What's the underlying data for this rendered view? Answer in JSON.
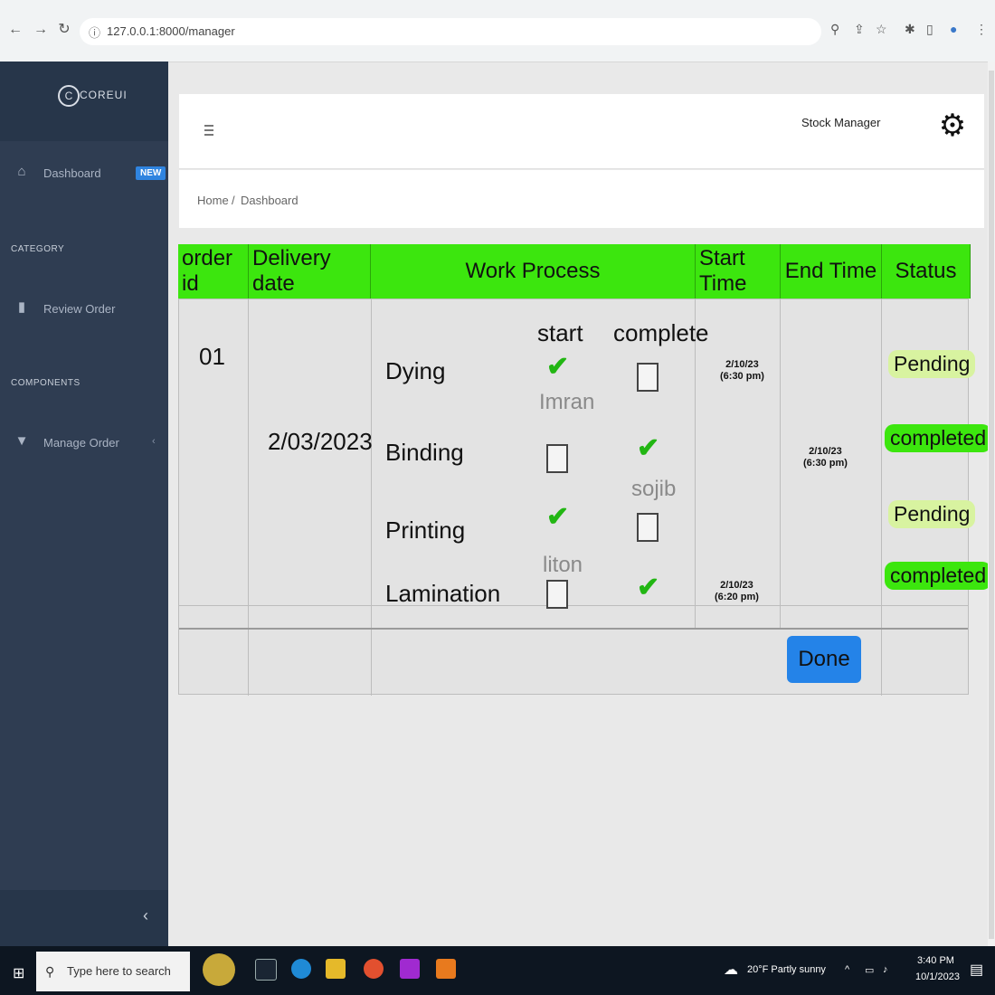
{
  "browser": {
    "url": "127.0.0.1:8000/manager",
    "nav": [
      "back-icon",
      "forward-icon",
      "reload-icon"
    ],
    "toolbar_icons": [
      "zoom-icon",
      "share-icon",
      "star-icon",
      "extensions-icon",
      "sidebar-icon",
      "profile-icon",
      "menu-icon"
    ]
  },
  "sidebar": {
    "brand": "COREUI",
    "dashboard": {
      "label": "Dashboard",
      "badge": "NEW"
    },
    "category_title": "CATEGORY",
    "review_order": "Review Order",
    "components_title": "COMPONENTS",
    "manage_order": "Manage Order",
    "collapse_icon": "chevron-left-icon"
  },
  "header": {
    "user": "Stock Manager",
    "settings_icon": "gear-icon"
  },
  "breadcrumb": {
    "home": "Home",
    "sep": "/",
    "current": "Dashboard"
  },
  "table": {
    "headers": [
      "order id",
      "Delivery date",
      "Work Process",
      "Start Time",
      "End Time",
      "Status"
    ],
    "order_id": "01",
    "delivery_date": "2/03/2023",
    "col_start": "start",
    "col_complete": "complete",
    "steps": [
      {
        "name": "Dying",
        "start": true,
        "complete": false,
        "worker": "Imran",
        "status": "Pending"
      },
      {
        "name": "Binding",
        "start": false,
        "complete": true,
        "worker": "sojib",
        "status": "completed"
      },
      {
        "name": "Printing",
        "start": true,
        "complete": false,
        "worker": "liton",
        "status": "Pending"
      },
      {
        "name": "Lamination",
        "start": false,
        "complete": true,
        "worker": "",
        "status": "completed"
      }
    ],
    "start_time_1": {
      "date": "2/10/23",
      "time": "(6:30 pm)"
    },
    "end_time": {
      "date": "2/10/23",
      "time": "(6:30 pm)"
    },
    "start_time_2": {
      "date": "2/10/23",
      "time": "(6:20 pm)"
    },
    "done_label": "Done"
  },
  "taskbar": {
    "search_placeholder": "Type here to search",
    "weather": "20°F Partly sunny",
    "time": "3:40 PM",
    "date": "10/1/2023"
  }
}
